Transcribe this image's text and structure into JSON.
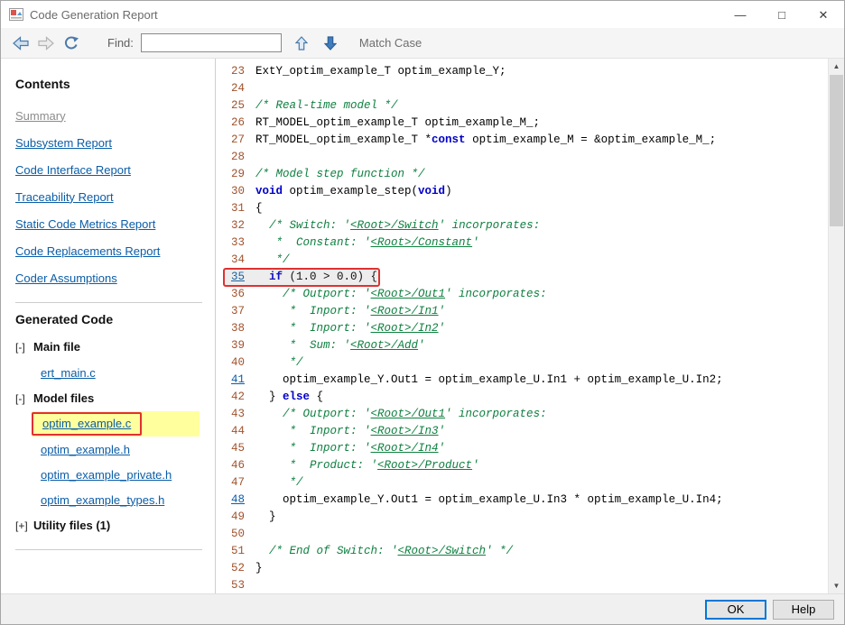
{
  "window": {
    "title": "Code Generation Report",
    "controls": {
      "minimize": "—",
      "maximize": "□",
      "close": "✕"
    }
  },
  "toolbar": {
    "find_label": "Find:",
    "find_value": "",
    "match_case_label": "Match Case"
  },
  "icons": {
    "titlebar": "report-icon",
    "navigation": [
      "back-arrow-icon",
      "forward-arrow-icon",
      "refresh-icon"
    ],
    "find": [
      "find-previous-icon",
      "find-next-icon"
    ],
    "scrollbar": {
      "up_glyph": "▲",
      "down_glyph": "▼"
    }
  },
  "colors": {
    "link_blue": "#0b5da8",
    "annotation_red": "#e03131",
    "highlight_yellow": "#ffff9e",
    "comment_green": "#0f8040",
    "keyword_blue": "#0000c8",
    "line_number_brown": "#a0522d"
  },
  "sidebar": {
    "contents_header": "Contents",
    "nav": [
      {
        "label": "Summary",
        "current": true
      },
      {
        "label": "Subsystem Report",
        "current": false
      },
      {
        "label": "Code Interface Report",
        "current": false
      },
      {
        "label": "Traceability Report",
        "current": false
      },
      {
        "label": "Static Code Metrics Report",
        "current": false
      },
      {
        "label": "Code Replacements Report",
        "current": false
      },
      {
        "label": "Coder Assumptions",
        "current": false
      }
    ],
    "generated_header": "Generated Code",
    "tree": [
      {
        "expander": "[-]",
        "label": "Main file",
        "files": [
          {
            "name": "ert_main.c",
            "highlighted": false
          }
        ]
      },
      {
        "expander": "[-]",
        "label": "Model files",
        "files": [
          {
            "name": "optim_example.c",
            "highlighted": true
          },
          {
            "name": "optim_example.h",
            "highlighted": false
          },
          {
            "name": "optim_example_private.h",
            "highlighted": false
          },
          {
            "name": "optim_example_types.h",
            "highlighted": false
          }
        ]
      },
      {
        "expander": "[+]",
        "label": "Utility files (1)",
        "files": []
      }
    ]
  },
  "code": {
    "lines": [
      {
        "num": "23",
        "num_link": false,
        "redbox": false,
        "seg": [
          {
            "t": "p",
            "x": "ExtY_optim_example_T optim_example_Y;"
          }
        ]
      },
      {
        "num": "24",
        "num_link": false,
        "redbox": false,
        "seg": []
      },
      {
        "num": "25",
        "num_link": false,
        "redbox": false,
        "seg": [
          {
            "t": "c",
            "x": "/* Real-time model */"
          }
        ]
      },
      {
        "num": "26",
        "num_link": false,
        "redbox": false,
        "seg": [
          {
            "t": "p",
            "x": "RT_MODEL_optim_example_T optim_example_M_;"
          }
        ]
      },
      {
        "num": "27",
        "num_link": false,
        "redbox": false,
        "seg": [
          {
            "t": "p",
            "x": "RT_MODEL_optim_example_T *"
          },
          {
            "t": "k",
            "x": "const"
          },
          {
            "t": "p",
            "x": " optim_example_M = &optim_example_M_;"
          }
        ]
      },
      {
        "num": "28",
        "num_link": false,
        "redbox": false,
        "seg": []
      },
      {
        "num": "29",
        "num_link": false,
        "redbox": false,
        "seg": [
          {
            "t": "c",
            "x": "/* Model step function */"
          }
        ]
      },
      {
        "num": "30",
        "num_link": false,
        "redbox": false,
        "seg": [
          {
            "t": "k",
            "x": "void"
          },
          {
            "t": "p",
            "x": " optim_example_step("
          },
          {
            "t": "k",
            "x": "void"
          },
          {
            "t": "p",
            "x": ")"
          }
        ]
      },
      {
        "num": "31",
        "num_link": false,
        "redbox": false,
        "seg": [
          {
            "t": "p",
            "x": "{"
          }
        ]
      },
      {
        "num": "32",
        "num_link": false,
        "redbox": false,
        "seg": [
          {
            "t": "c",
            "x": "  /* Switch: '"
          },
          {
            "t": "cl",
            "x": "<Root>/Switch"
          },
          {
            "t": "c",
            "x": "' incorporates:"
          }
        ]
      },
      {
        "num": "33",
        "num_link": false,
        "redbox": false,
        "seg": [
          {
            "t": "c",
            "x": "   *  Constant: '"
          },
          {
            "t": "cl",
            "x": "<Root>/Constant"
          },
          {
            "t": "c",
            "x": "'"
          }
        ]
      },
      {
        "num": "34",
        "num_link": false,
        "redbox": false,
        "seg": [
          {
            "t": "c",
            "x": "   */"
          }
        ]
      },
      {
        "num": "35",
        "num_link": true,
        "redbox": true,
        "seg": [
          {
            "t": "p",
            "x": "  "
          },
          {
            "t": "k",
            "x": "if"
          },
          {
            "t": "p",
            "x": " (1.0 > 0.0) {"
          }
        ]
      },
      {
        "num": "36",
        "num_link": false,
        "redbox": false,
        "seg": [
          {
            "t": "c",
            "x": "    /* Outport: '"
          },
          {
            "t": "cl",
            "x": "<Root>/Out1"
          },
          {
            "t": "c",
            "x": "' incorporates:"
          }
        ]
      },
      {
        "num": "37",
        "num_link": false,
        "redbox": false,
        "seg": [
          {
            "t": "c",
            "x": "     *  Inport: '"
          },
          {
            "t": "cl",
            "x": "<Root>/In1"
          },
          {
            "t": "c",
            "x": "'"
          }
        ]
      },
      {
        "num": "38",
        "num_link": false,
        "redbox": false,
        "seg": [
          {
            "t": "c",
            "x": "     *  Inport: '"
          },
          {
            "t": "cl",
            "x": "<Root>/In2"
          },
          {
            "t": "c",
            "x": "'"
          }
        ]
      },
      {
        "num": "39",
        "num_link": false,
        "redbox": false,
        "seg": [
          {
            "t": "c",
            "x": "     *  Sum: '"
          },
          {
            "t": "cl",
            "x": "<Root>/Add"
          },
          {
            "t": "c",
            "x": "'"
          }
        ]
      },
      {
        "num": "40",
        "num_link": false,
        "redbox": false,
        "seg": [
          {
            "t": "c",
            "x": "     */"
          }
        ]
      },
      {
        "num": "41",
        "num_link": true,
        "redbox": false,
        "seg": [
          {
            "t": "p",
            "x": "    optim_example_Y.Out1 = optim_example_U.In1 + optim_example_U.In2;"
          }
        ]
      },
      {
        "num": "42",
        "num_link": false,
        "redbox": false,
        "seg": [
          {
            "t": "p",
            "x": "  } "
          },
          {
            "t": "k",
            "x": "else"
          },
          {
            "t": "p",
            "x": " {"
          }
        ]
      },
      {
        "num": "43",
        "num_link": false,
        "redbox": false,
        "seg": [
          {
            "t": "c",
            "x": "    /* Outport: '"
          },
          {
            "t": "cl",
            "x": "<Root>/Out1"
          },
          {
            "t": "c",
            "x": "' incorporates:"
          }
        ]
      },
      {
        "num": "44",
        "num_link": false,
        "redbox": false,
        "seg": [
          {
            "t": "c",
            "x": "     *  Inport: '"
          },
          {
            "t": "cl",
            "x": "<Root>/In3"
          },
          {
            "t": "c",
            "x": "'"
          }
        ]
      },
      {
        "num": "45",
        "num_link": false,
        "redbox": false,
        "seg": [
          {
            "t": "c",
            "x": "     *  Inport: '"
          },
          {
            "t": "cl",
            "x": "<Root>/In4"
          },
          {
            "t": "c",
            "x": "'"
          }
        ]
      },
      {
        "num": "46",
        "num_link": false,
        "redbox": false,
        "seg": [
          {
            "t": "c",
            "x": "     *  Product: '"
          },
          {
            "t": "cl",
            "x": "<Root>/Product"
          },
          {
            "t": "c",
            "x": "'"
          }
        ]
      },
      {
        "num": "47",
        "num_link": false,
        "redbox": false,
        "seg": [
          {
            "t": "c",
            "x": "     */"
          }
        ]
      },
      {
        "num": "48",
        "num_link": true,
        "redbox": false,
        "seg": [
          {
            "t": "p",
            "x": "    optim_example_Y.Out1 = optim_example_U.In3 * optim_example_U.In4;"
          }
        ]
      },
      {
        "num": "49",
        "num_link": false,
        "redbox": false,
        "seg": [
          {
            "t": "p",
            "x": "  }"
          }
        ]
      },
      {
        "num": "50",
        "num_link": false,
        "redbox": false,
        "seg": []
      },
      {
        "num": "51",
        "num_link": false,
        "redbox": false,
        "seg": [
          {
            "t": "c",
            "x": "  /* End of Switch: '"
          },
          {
            "t": "cl",
            "x": "<Root>/Switch"
          },
          {
            "t": "c",
            "x": "' */"
          }
        ]
      },
      {
        "num": "52",
        "num_link": false,
        "redbox": false,
        "seg": [
          {
            "t": "p",
            "x": "}"
          }
        ]
      },
      {
        "num": "53",
        "num_link": false,
        "redbox": false,
        "seg": []
      }
    ]
  },
  "footer": {
    "ok_label": "OK",
    "help_label": "Help"
  }
}
